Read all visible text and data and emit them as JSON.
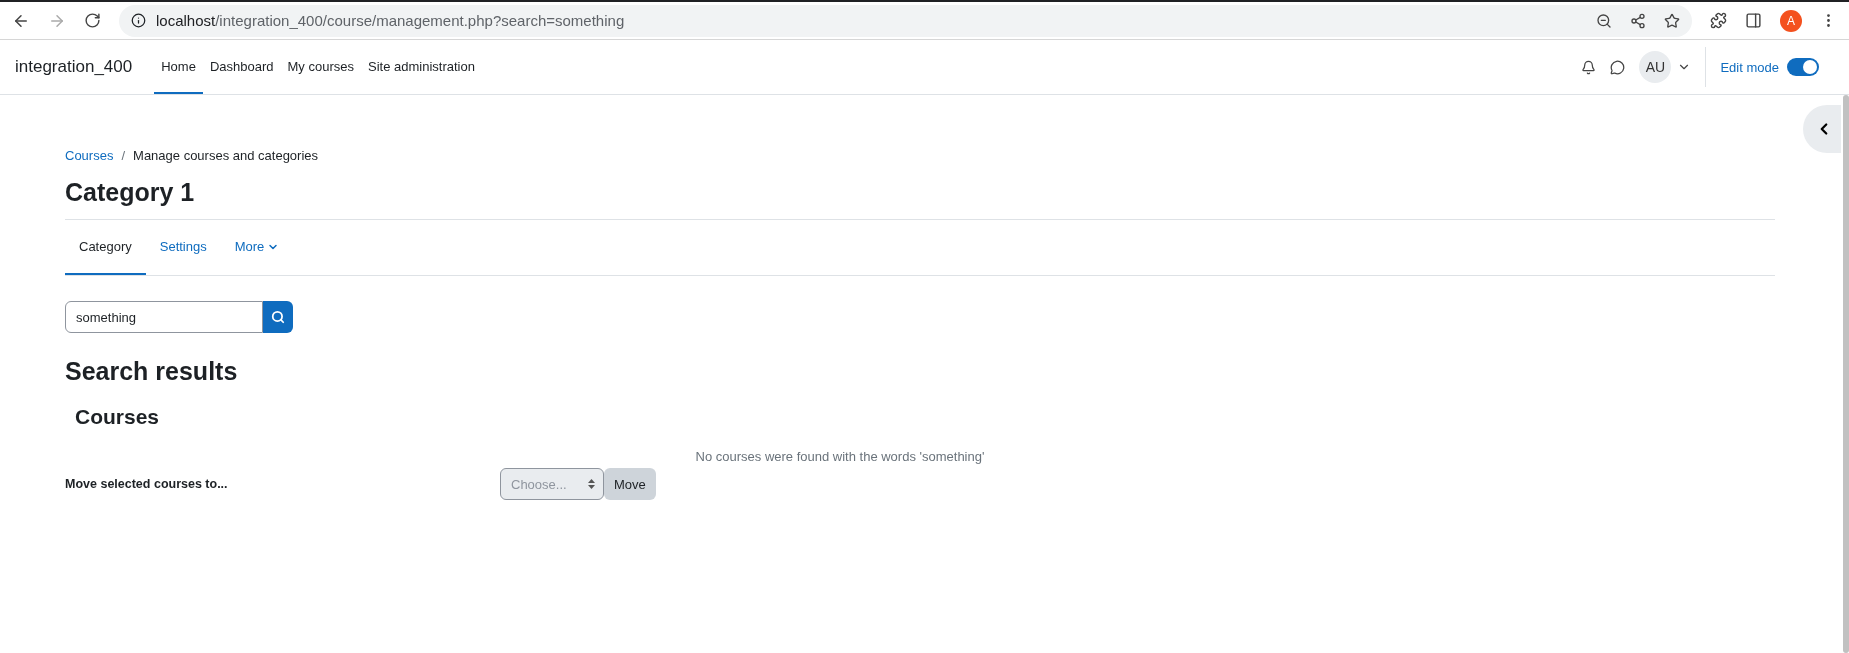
{
  "browser": {
    "url_host": "localhost",
    "url_path": "/integration_400/course/management.php?search=something",
    "profile": "A"
  },
  "navbar": {
    "brand": "integration_400",
    "items": [
      {
        "label": "Home",
        "selected": true
      },
      {
        "label": "Dashboard",
        "selected": false
      },
      {
        "label": "My courses",
        "selected": false
      },
      {
        "label": "Site administration",
        "selected": false
      }
    ],
    "user_initials": "AU",
    "edit_mode": {
      "label": "Edit mode",
      "on": true
    }
  },
  "breadcrumb_separator": "/",
  "breadcrumb": [
    {
      "label": "Courses",
      "kind": "link"
    },
    {
      "label": "Manage courses and categories",
      "kind": "current"
    }
  ],
  "heading": "Category 1",
  "tabs": [
    {
      "label": "Category",
      "selected": true,
      "has_menu": false
    },
    {
      "label": "Settings",
      "selected": false,
      "has_menu": false
    },
    {
      "label": "More",
      "selected": false,
      "has_menu": true
    }
  ],
  "search": {
    "value": "something"
  },
  "results_title": "Search results",
  "section_title": "Courses",
  "empty_message": "No courses were found with the words 'something'",
  "move": {
    "label": "Move selected courses to...",
    "placeholder": "Choose...",
    "disabled": true,
    "button": "Move"
  }
}
